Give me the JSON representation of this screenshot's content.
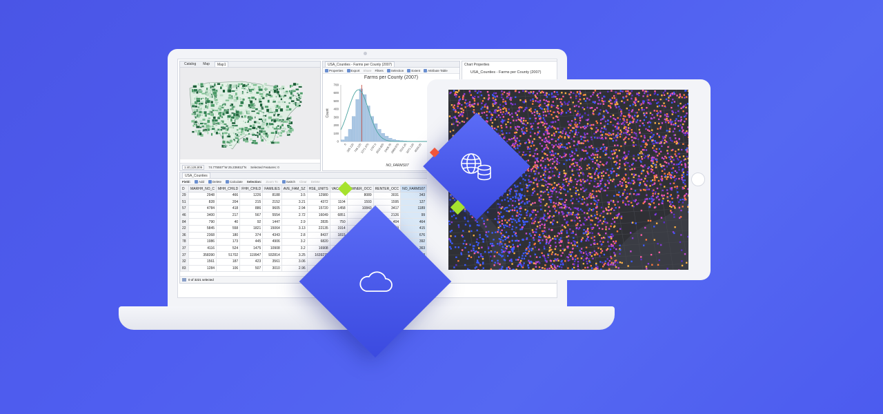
{
  "map_pane": {
    "tabs": [
      "Catalog",
      "Map",
      "Map1"
    ],
    "scale": "1:40,128,806",
    "coordinates": "74.775557°W 25.236812°N",
    "selected_features": "Selected Features: 0"
  },
  "chart_pane": {
    "tab": "USA_Counties - Farms per County (2007)",
    "toolbar": [
      "Properties",
      "Export",
      "Filters",
      "Selection",
      "Extent",
      "Attribute Table"
    ],
    "toolbar_disabled": [
      "Share"
    ],
    "chart_data": {
      "type": "bar",
      "title": "Farms per County (2007)",
      "xlabel": "NO_FARMS07",
      "ylabel": "Count",
      "ylim": [
        0,
        700
      ],
      "yticks": [
        "700",
        "600",
        "500",
        "400",
        "300",
        "200",
        "100",
        "0"
      ],
      "xticks": [
        "0",
        "325.125",
        "748.125",
        "1371.375",
        "1797.5",
        "2023.625",
        "2408.75",
        "2969.875",
        "3114.25",
        "3371.125",
        "4039.25"
      ],
      "values": [
        20,
        60,
        150,
        310,
        520,
        650,
        580,
        440,
        310,
        220,
        150,
        100,
        65,
        40,
        25,
        15,
        10,
        6,
        4,
        3,
        2,
        1,
        1,
        1
      ],
      "mean_value": 1064,
      "colors": {
        "bars": "#a9c6e3",
        "curve": "#4aa3a0",
        "mean": "#c0392b"
      }
    }
  },
  "props_pane": {
    "title": "Chart Properties",
    "subtitle": "USA_Counties - Farms per County (2007)"
  },
  "table_pane": {
    "tab": "USA_Counties",
    "field_tools": [
      "Field:",
      "Add",
      "Delete",
      "Calculate",
      "Selection:",
      "Zoom To",
      "Switch",
      "Clear",
      "Delete"
    ],
    "columns": [
      "D",
      "MARHH_NO_C",
      "MHH_CHILD",
      "FHH_CHILD",
      "FAMILIES",
      "AVE_FAM_SZ",
      "HSE_UNITS",
      "VACANT",
      "OWNER_OCC",
      "RENTER_OCC",
      "NO_FARMS07"
    ],
    "rows": [
      [
        "29",
        "2948",
        "466",
        "1226",
        "8188",
        "3.5",
        "12980",
        "",
        "8089",
        "3031",
        "343"
      ],
      [
        "51",
        "828",
        "204",
        "215",
        "2152",
        "3.21",
        "4372",
        "1104",
        "1593",
        "1595",
        "127"
      ],
      [
        "57",
        "4784",
        "418",
        "886",
        "9605",
        "2.94",
        "15720",
        "1458",
        "10843",
        "3417",
        "1189"
      ],
      [
        "46",
        "3400",
        "217",
        "567",
        "5554",
        "2.72",
        "16049",
        "6851",
        "",
        "2126",
        "99"
      ],
      [
        "84",
        "790",
        "40",
        "92",
        "1447",
        "2.9",
        "2835",
        "750",
        "",
        "404",
        "464"
      ],
      [
        "22",
        "5845",
        "558",
        "1821",
        "15064",
        "3.13",
        "22135",
        "1914",
        "",
        "3773",
        "415"
      ],
      [
        "36",
        "2368",
        "180",
        "374",
        "4343",
        "2.8",
        "8437",
        "1815",
        "",
        "",
        "676"
      ],
      [
        "78",
        "1986",
        "173",
        "445",
        "4906",
        "3.2",
        "6820",
        "",
        "",
        "",
        "392"
      ],
      [
        "37",
        "4116",
        "524",
        "1475",
        "10908",
        "3.2",
        "16908",
        "",
        "",
        "",
        "363"
      ],
      [
        "37",
        "358390",
        "51702",
        "119947",
        "932814",
        "3.25",
        "1639279",
        "",
        "",
        "",
        "2578"
      ],
      [
        "32",
        "1561",
        "187",
        "423",
        "3561",
        "3.06",
        "",
        "",
        "",
        "",
        "120"
      ],
      [
        "83",
        "1284",
        "106",
        "507",
        "3010",
        "2.96",
        "",
        "",
        "",
        "",
        "176"
      ]
    ],
    "status": "0 of 3221 selected"
  },
  "icons": {
    "cloud": "cloud-icon",
    "globe": "globe-icon",
    "database": "database-icon"
  },
  "colors": {
    "background": "#4f5ef0",
    "diamond": "#4656ea",
    "accent_green": "#a6e22e",
    "accent_red": "#f0553c",
    "map_green": "#2e7d4f"
  }
}
